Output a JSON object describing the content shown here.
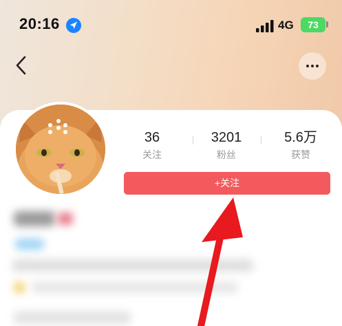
{
  "status_bar": {
    "time": "20:16",
    "network": "4G",
    "battery": "73"
  },
  "nav": {
    "back_icon": "chevron-left-icon",
    "more_icon": "more-horizontal-icon"
  },
  "profile": {
    "avatar": "cat-avatar",
    "stats": [
      {
        "value": "36",
        "label": "关注"
      },
      {
        "value": "3201",
        "label": "粉丝"
      },
      {
        "value": "5.6万",
        "label": "获赞"
      }
    ],
    "follow_button": "+关注"
  },
  "colors": {
    "follow_button": "#f25a5d",
    "annotation_arrow": "#e8191f",
    "battery": "#4cd964",
    "location_icon": "#1a84ff"
  }
}
